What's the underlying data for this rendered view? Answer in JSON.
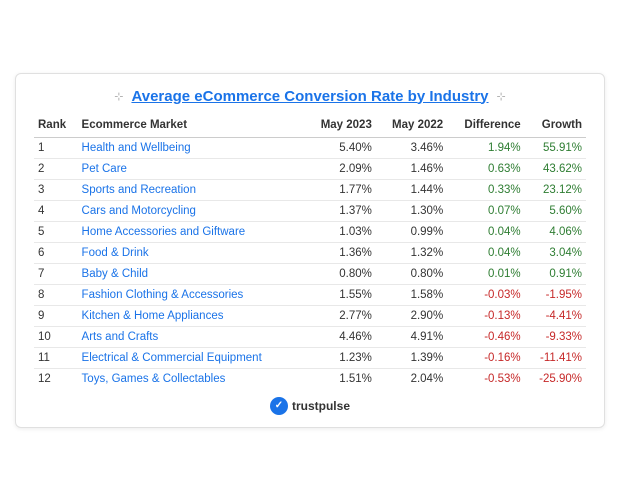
{
  "title": "Average eCommerce Conversion Rate by Industry",
  "columns": [
    "Rank",
    "Ecommerce Market",
    "May 2023",
    "May 2022",
    "Difference",
    "Growth"
  ],
  "rows": [
    {
      "rank": "1",
      "market": "Health and Wellbeing",
      "may2023": "5.40%",
      "may2022": "3.46%",
      "diff": "1.94%",
      "growth": "55.91%",
      "diffSign": "pos",
      "growthSign": "pos"
    },
    {
      "rank": "2",
      "market": "Pet Care",
      "may2023": "2.09%",
      "may2022": "1.46%",
      "diff": "0.63%",
      "growth": "43.62%",
      "diffSign": "pos",
      "growthSign": "pos"
    },
    {
      "rank": "3",
      "market": "Sports and Recreation",
      "may2023": "1.77%",
      "may2022": "1.44%",
      "diff": "0.33%",
      "growth": "23.12%",
      "diffSign": "pos",
      "growthSign": "pos"
    },
    {
      "rank": "4",
      "market": "Cars and Motorcycling",
      "may2023": "1.37%",
      "may2022": "1.30%",
      "diff": "0.07%",
      "growth": "5.60%",
      "diffSign": "pos",
      "growthSign": "pos"
    },
    {
      "rank": "5",
      "market": "Home Accessories and Giftware",
      "may2023": "1.03%",
      "may2022": "0.99%",
      "diff": "0.04%",
      "growth": "4.06%",
      "diffSign": "pos",
      "growthSign": "pos"
    },
    {
      "rank": "6",
      "market": "Food & Drink",
      "may2023": "1.36%",
      "may2022": "1.32%",
      "diff": "0.04%",
      "growth": "3.04%",
      "diffSign": "pos",
      "growthSign": "pos"
    },
    {
      "rank": "7",
      "market": "Baby & Child",
      "may2023": "0.80%",
      "may2022": "0.80%",
      "diff": "0.01%",
      "growth": "0.91%",
      "diffSign": "pos",
      "growthSign": "pos"
    },
    {
      "rank": "8",
      "market": "Fashion Clothing & Accessories",
      "may2023": "1.55%",
      "may2022": "1.58%",
      "diff": "-0.03%",
      "growth": "-1.95%",
      "diffSign": "neg",
      "growthSign": "neg"
    },
    {
      "rank": "9",
      "market": "Kitchen & Home Appliances",
      "may2023": "2.77%",
      "may2022": "2.90%",
      "diff": "-0.13%",
      "growth": "-4.41%",
      "diffSign": "neg",
      "growthSign": "neg"
    },
    {
      "rank": "10",
      "market": "Arts and Crafts",
      "may2023": "4.46%",
      "may2022": "4.91%",
      "diff": "-0.46%",
      "growth": "-9.33%",
      "diffSign": "neg",
      "growthSign": "neg"
    },
    {
      "rank": "11",
      "market": "Electrical & Commercial Equipment",
      "may2023": "1.23%",
      "may2022": "1.39%",
      "diff": "-0.16%",
      "growth": "-11.41%",
      "diffSign": "neg",
      "growthSign": "neg"
    },
    {
      "rank": "12",
      "market": "Toys, Games & Collectables",
      "may2023": "1.51%",
      "may2022": "2.04%",
      "diff": "-0.53%",
      "growth": "-25.90%",
      "diffSign": "neg",
      "growthSign": "neg"
    }
  ],
  "footer": {
    "brand": "trustpulse"
  }
}
